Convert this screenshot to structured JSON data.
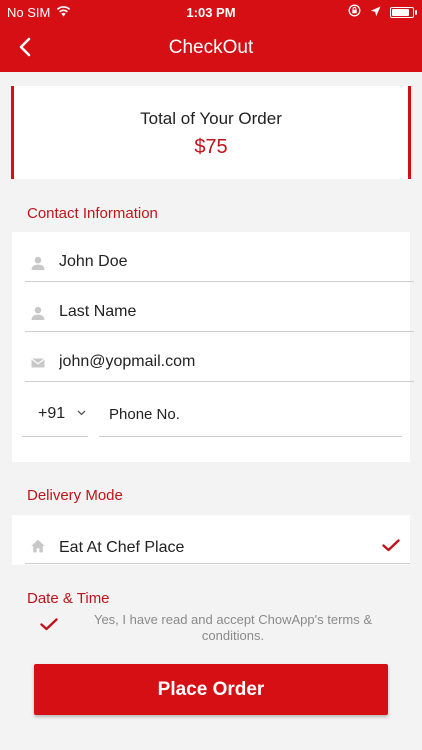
{
  "status_bar": {
    "carrier": "No SIM",
    "time": "1:03 PM",
    "battery_level": 0.9,
    "icons": [
      "wifi-icon",
      "orientation-lock-icon",
      "location-arrow-icon",
      "battery-icon"
    ]
  },
  "nav": {
    "title": "CheckOut",
    "back_icon": "chevron-left-icon"
  },
  "order_total": {
    "label": "Total of Your Order",
    "amount": "$75"
  },
  "contact": {
    "section_title": "Contact Information",
    "first_name": {
      "value": "John Doe",
      "icon": "person-icon"
    },
    "last_name": {
      "placeholder": "Last Name",
      "icon": "person-icon"
    },
    "email": {
      "value": "john@yopmail.com",
      "icon": "envelope-icon"
    },
    "phone": {
      "country_code": "+91",
      "placeholder": "Phone No.",
      "chevron_icon": "chevron-down-icon"
    }
  },
  "delivery": {
    "section_title": "Delivery Mode",
    "option_label": "Eat At Chef Place",
    "option_icon": "home-icon",
    "selected": true
  },
  "date_time": {
    "section_title": "Date & Time"
  },
  "terms": {
    "text": "Yes, I have read and accept ChowApp's terms & conditions.",
    "checked": true
  },
  "place_order": {
    "label": "Place Order"
  },
  "colors": {
    "accent": "#d50f14",
    "section_text": "#c0141a",
    "background": "#f3f3f3",
    "muted_text": "#8a8a8a",
    "divider": "#cfcfcf"
  }
}
